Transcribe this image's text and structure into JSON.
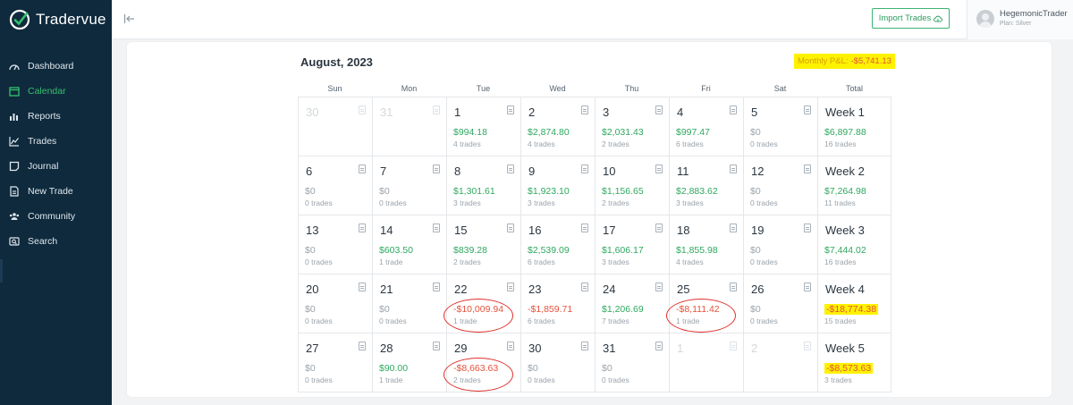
{
  "brand": {
    "name": "Tradervue"
  },
  "sidebar": {
    "items": [
      {
        "label": "Dashboard",
        "icon": "dashboard-icon",
        "active": false
      },
      {
        "label": "Calendar",
        "icon": "calendar-icon",
        "active": true
      },
      {
        "label": "Reports",
        "icon": "reports-icon",
        "active": false
      },
      {
        "label": "Trades",
        "icon": "trades-icon",
        "active": false
      },
      {
        "label": "Journal",
        "icon": "journal-icon",
        "active": false
      },
      {
        "label": "New Trade",
        "icon": "new-trade-icon",
        "active": false
      },
      {
        "label": "Community",
        "icon": "community-icon",
        "active": false
      },
      {
        "label": "Search",
        "icon": "search-icon",
        "active": false
      }
    ]
  },
  "topbar": {
    "import_label": "Import Trades",
    "user_name": "HegemonicTrader",
    "user_plan": "Plan: Silver"
  },
  "calendar": {
    "title": "August, 2023",
    "monthly_pnl_label": "Monthly P&L:",
    "monthly_pnl_value": "-$5,741.13",
    "day_headers": [
      "Sun",
      "Mon",
      "Tue",
      "Wed",
      "Thu",
      "Fri",
      "Sat",
      "Total"
    ],
    "weeks": [
      {
        "days": [
          {
            "num": "30",
            "dim": true
          },
          {
            "num": "31",
            "dim": true
          },
          {
            "num": "1",
            "pnl": "$994.18",
            "trades": "4 trades",
            "sign": "pos"
          },
          {
            "num": "2",
            "pnl": "$2,874.80",
            "trades": "4 trades",
            "sign": "pos"
          },
          {
            "num": "3",
            "pnl": "$2,031.43",
            "trades": "2 trades",
            "sign": "pos"
          },
          {
            "num": "4",
            "pnl": "$997.47",
            "trades": "6 trades",
            "sign": "pos"
          },
          {
            "num": "5",
            "pnl": "$0",
            "trades": "0 trades",
            "sign": "zero"
          }
        ],
        "total": {
          "label": "Week 1",
          "pnl": "$6,897.88",
          "trades": "16 trades",
          "sign": "pos"
        }
      },
      {
        "days": [
          {
            "num": "6",
            "pnl": "$0",
            "trades": "0 trades",
            "sign": "zero"
          },
          {
            "num": "7",
            "pnl": "$0",
            "trades": "0 trades",
            "sign": "zero"
          },
          {
            "num": "8",
            "pnl": "$1,301.61",
            "trades": "3 trades",
            "sign": "pos"
          },
          {
            "num": "9",
            "pnl": "$1,923.10",
            "trades": "3 trades",
            "sign": "pos"
          },
          {
            "num": "10",
            "pnl": "$1,156.65",
            "trades": "2 trades",
            "sign": "pos"
          },
          {
            "num": "11",
            "pnl": "$2,883.62",
            "trades": "3 trades",
            "sign": "pos"
          },
          {
            "num": "12",
            "pnl": "$0",
            "trades": "0 trades",
            "sign": "zero"
          }
        ],
        "total": {
          "label": "Week 2",
          "pnl": "$7,264.98",
          "trades": "11 trades",
          "sign": "pos"
        }
      },
      {
        "days": [
          {
            "num": "13",
            "pnl": "$0",
            "trades": "0 trades",
            "sign": "zero"
          },
          {
            "num": "14",
            "pnl": "$603.50",
            "trades": "1 trade",
            "sign": "pos"
          },
          {
            "num": "15",
            "pnl": "$839.28",
            "trades": "2 trades",
            "sign": "pos"
          },
          {
            "num": "16",
            "pnl": "$2,539.09",
            "trades": "6 trades",
            "sign": "pos"
          },
          {
            "num": "17",
            "pnl": "$1,606.17",
            "trades": "3 trades",
            "sign": "pos"
          },
          {
            "num": "18",
            "pnl": "$1,855.98",
            "trades": "4 trades",
            "sign": "pos"
          },
          {
            "num": "19",
            "pnl": "$0",
            "trades": "0 trades",
            "sign": "zero"
          }
        ],
        "total": {
          "label": "Week 3",
          "pnl": "$7,444.02",
          "trades": "16 trades",
          "sign": "pos"
        }
      },
      {
        "days": [
          {
            "num": "20",
            "pnl": "$0",
            "trades": "0 trades",
            "sign": "zero"
          },
          {
            "num": "21",
            "pnl": "$0",
            "trades": "0 trades",
            "sign": "zero"
          },
          {
            "num": "22",
            "pnl": "-$10,009.94",
            "trades": "1 trade",
            "sign": "neg",
            "circled": true
          },
          {
            "num": "23",
            "pnl": "-$1,859.71",
            "trades": "6 trades",
            "sign": "neg"
          },
          {
            "num": "24",
            "pnl": "$1,206.69",
            "trades": "7 trades",
            "sign": "pos"
          },
          {
            "num": "25",
            "pnl": "-$8,111.42",
            "trades": "1 trade",
            "sign": "neg",
            "circled": true
          },
          {
            "num": "26",
            "pnl": "$0",
            "trades": "0 trades",
            "sign": "zero"
          }
        ],
        "total": {
          "label": "Week 4",
          "pnl": "-$18,774.38",
          "trades": "15 trades",
          "sign": "neg",
          "highlighted": true
        }
      },
      {
        "days": [
          {
            "num": "27",
            "pnl": "$0",
            "trades": "0 trades",
            "sign": "zero"
          },
          {
            "num": "28",
            "pnl": "$90.00",
            "trades": "1 trade",
            "sign": "pos"
          },
          {
            "num": "29",
            "pnl": "-$8,663.63",
            "trades": "2 trades",
            "sign": "neg",
            "circled": true
          },
          {
            "num": "30",
            "pnl": "$0",
            "trades": "0 trades",
            "sign": "zero"
          },
          {
            "num": "31",
            "pnl": "$0",
            "trades": "0 trades",
            "sign": "zero"
          },
          {
            "num": "1",
            "dim": true
          },
          {
            "num": "2",
            "dim": true
          }
        ],
        "total": {
          "label": "Week 5",
          "pnl": "-$8,573.63",
          "trades": "3 trades",
          "sign": "neg",
          "highlighted": true
        }
      }
    ]
  },
  "colors": {
    "sidebar_bg": "#0f2a3d",
    "accent_green": "#35c16f",
    "positive": "#2fa860",
    "negative": "#e5533c",
    "highlight": "#fff200"
  }
}
